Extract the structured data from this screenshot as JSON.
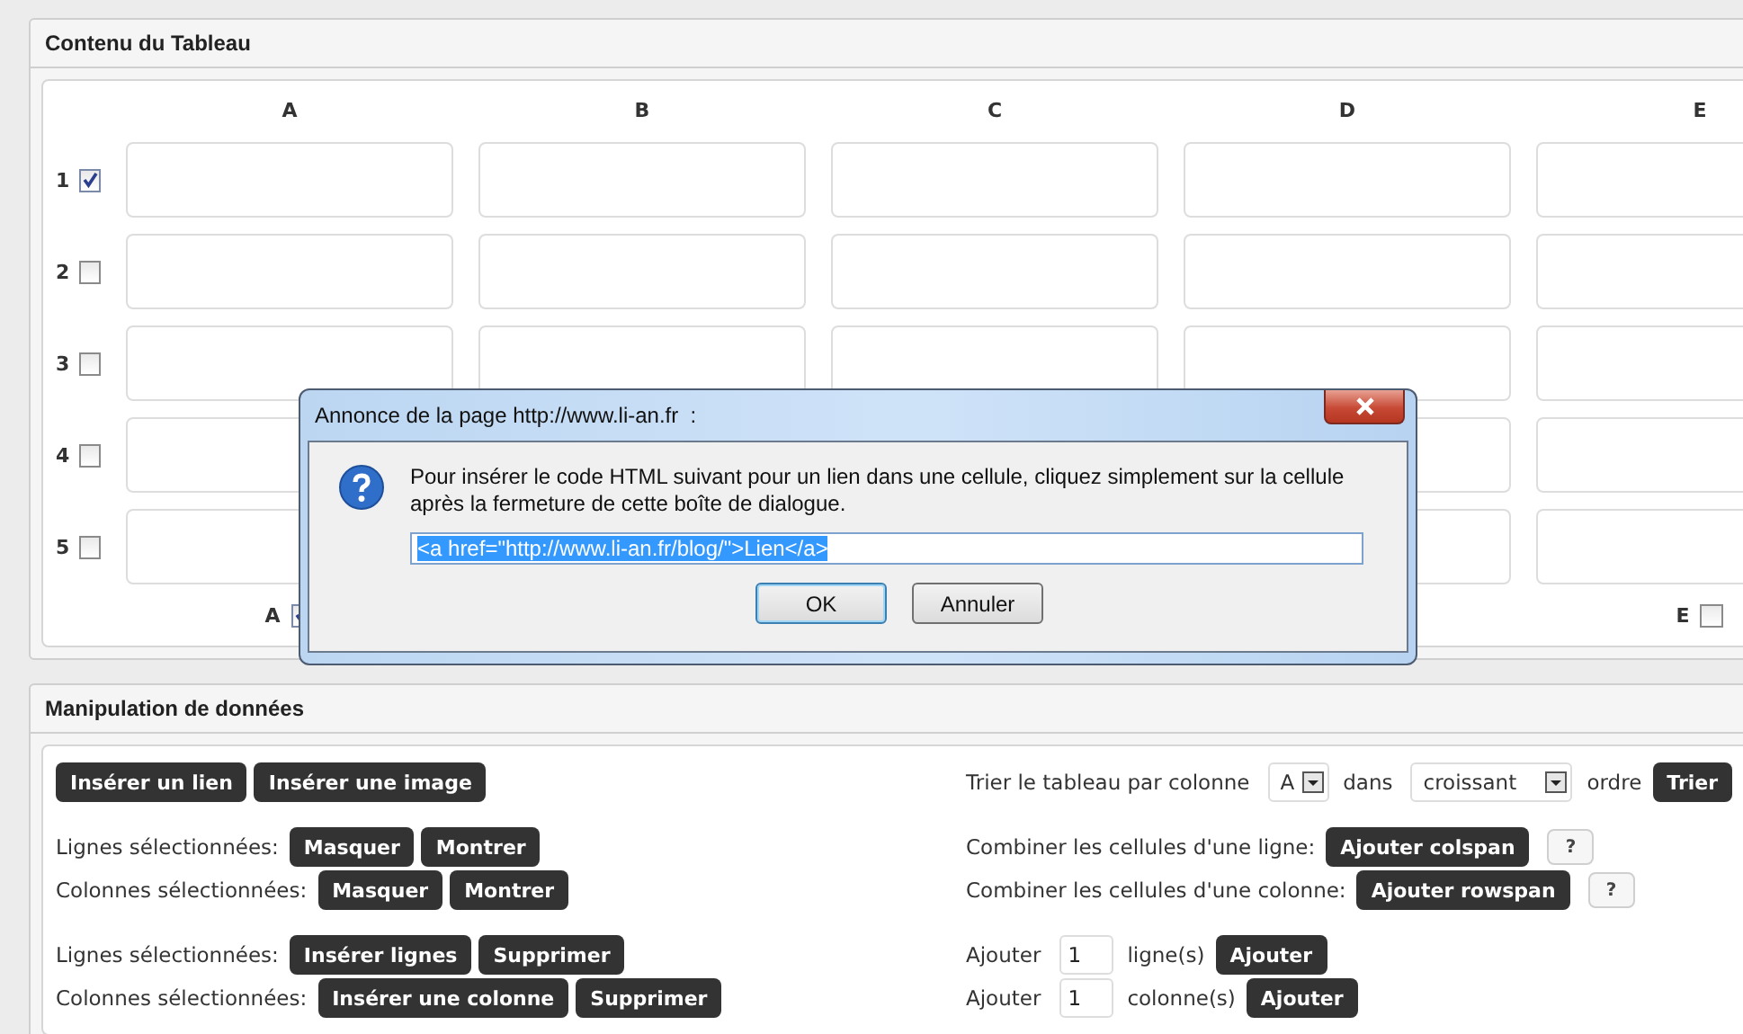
{
  "table_panel": {
    "title": "Contenu du Tableau",
    "columns": [
      {
        "label": "A",
        "toggle": {
          "label": "A",
          "checked": true
        }
      },
      {
        "label": "B"
      },
      {
        "label": "C"
      },
      {
        "label": "D"
      },
      {
        "label": "E",
        "toggle": {
          "label": "E",
          "checked": false
        }
      }
    ],
    "rows": [
      {
        "label": "1",
        "checked": true
      },
      {
        "label": "2",
        "checked": false
      },
      {
        "label": "3",
        "checked": false
      },
      {
        "label": "4",
        "checked": false
      },
      {
        "label": "5",
        "checked": false
      }
    ]
  },
  "dialog": {
    "title": "Annonce de la page http://www.li-an.fr  :",
    "message": "Pour insérer le code HTML suivant pour un lien dans une cellule, cliquez simplement sur la cellule après la fermeture de cette boîte de dialogue.",
    "value": "<a href=\"http://www.li-an.fr/blog/\">Lien</a>",
    "buttons": [
      "OK",
      "Annuler"
    ]
  },
  "data_panel": {
    "title": "Manipulation de données",
    "sections": [
      {
        "left": [
          [
            {
              "kind": "button",
              "label": "Insérer un lien"
            },
            {
              "kind": "button",
              "label": "Insérer une image"
            }
          ]
        ],
        "right": [
          [
            {
              "kind": "text",
              "label": "Trier le tableau par colonne"
            },
            {
              "kind": "select",
              "label": "A"
            },
            {
              "kind": "text",
              "label": "dans"
            },
            {
              "kind": "select",
              "label": "croissant"
            },
            {
              "kind": "text",
              "label": "ordre"
            },
            {
              "kind": "button",
              "label": "Trier"
            }
          ]
        ]
      },
      {
        "left": [
          [
            {
              "kind": "text",
              "label": "Lignes sélectionnées:"
            },
            {
              "kind": "button",
              "label": "Masquer"
            },
            {
              "kind": "button",
              "label": "Montrer"
            }
          ],
          [
            {
              "kind": "text",
              "label": "Colonnes sélectionnées:"
            },
            {
              "kind": "button",
              "label": "Masquer"
            },
            {
              "kind": "button",
              "label": "Montrer"
            }
          ]
        ],
        "right": [
          [
            {
              "kind": "text",
              "label": "Combiner les cellules d'une ligne:"
            },
            {
              "kind": "button",
              "label": "Ajouter colspan"
            },
            {
              "kind": "help",
              "label": "?"
            }
          ],
          [
            {
              "kind": "text",
              "label": "Combiner les cellules d'une colonne:"
            },
            {
              "kind": "button",
              "label": "Ajouter rowspan"
            },
            {
              "kind": "help",
              "label": "?"
            }
          ]
        ]
      },
      {
        "left": [
          [
            {
              "kind": "text",
              "label": "Lignes sélectionnées:"
            },
            {
              "kind": "button",
              "label": "Insérer lignes"
            },
            {
              "kind": "button",
              "label": "Supprimer"
            }
          ],
          [
            {
              "kind": "text",
              "label": "Colonnes sélectionnées:"
            },
            {
              "kind": "button",
              "label": "Insérer une colonne"
            },
            {
              "kind": "button",
              "label": "Supprimer"
            }
          ]
        ],
        "right": [
          [
            {
              "kind": "text",
              "label": "Ajouter"
            },
            {
              "kind": "input",
              "label": "1"
            },
            {
              "kind": "text",
              "label": "ligne(s)"
            },
            {
              "kind": "button",
              "label": "Ajouter"
            }
          ],
          [
            {
              "kind": "text",
              "label": "Ajouter"
            },
            {
              "kind": "input",
              "label": "1"
            },
            {
              "kind": "text",
              "label": "colonne(s)"
            },
            {
              "kind": "button",
              "label": "Ajouter"
            }
          ]
        ]
      }
    ]
  }
}
